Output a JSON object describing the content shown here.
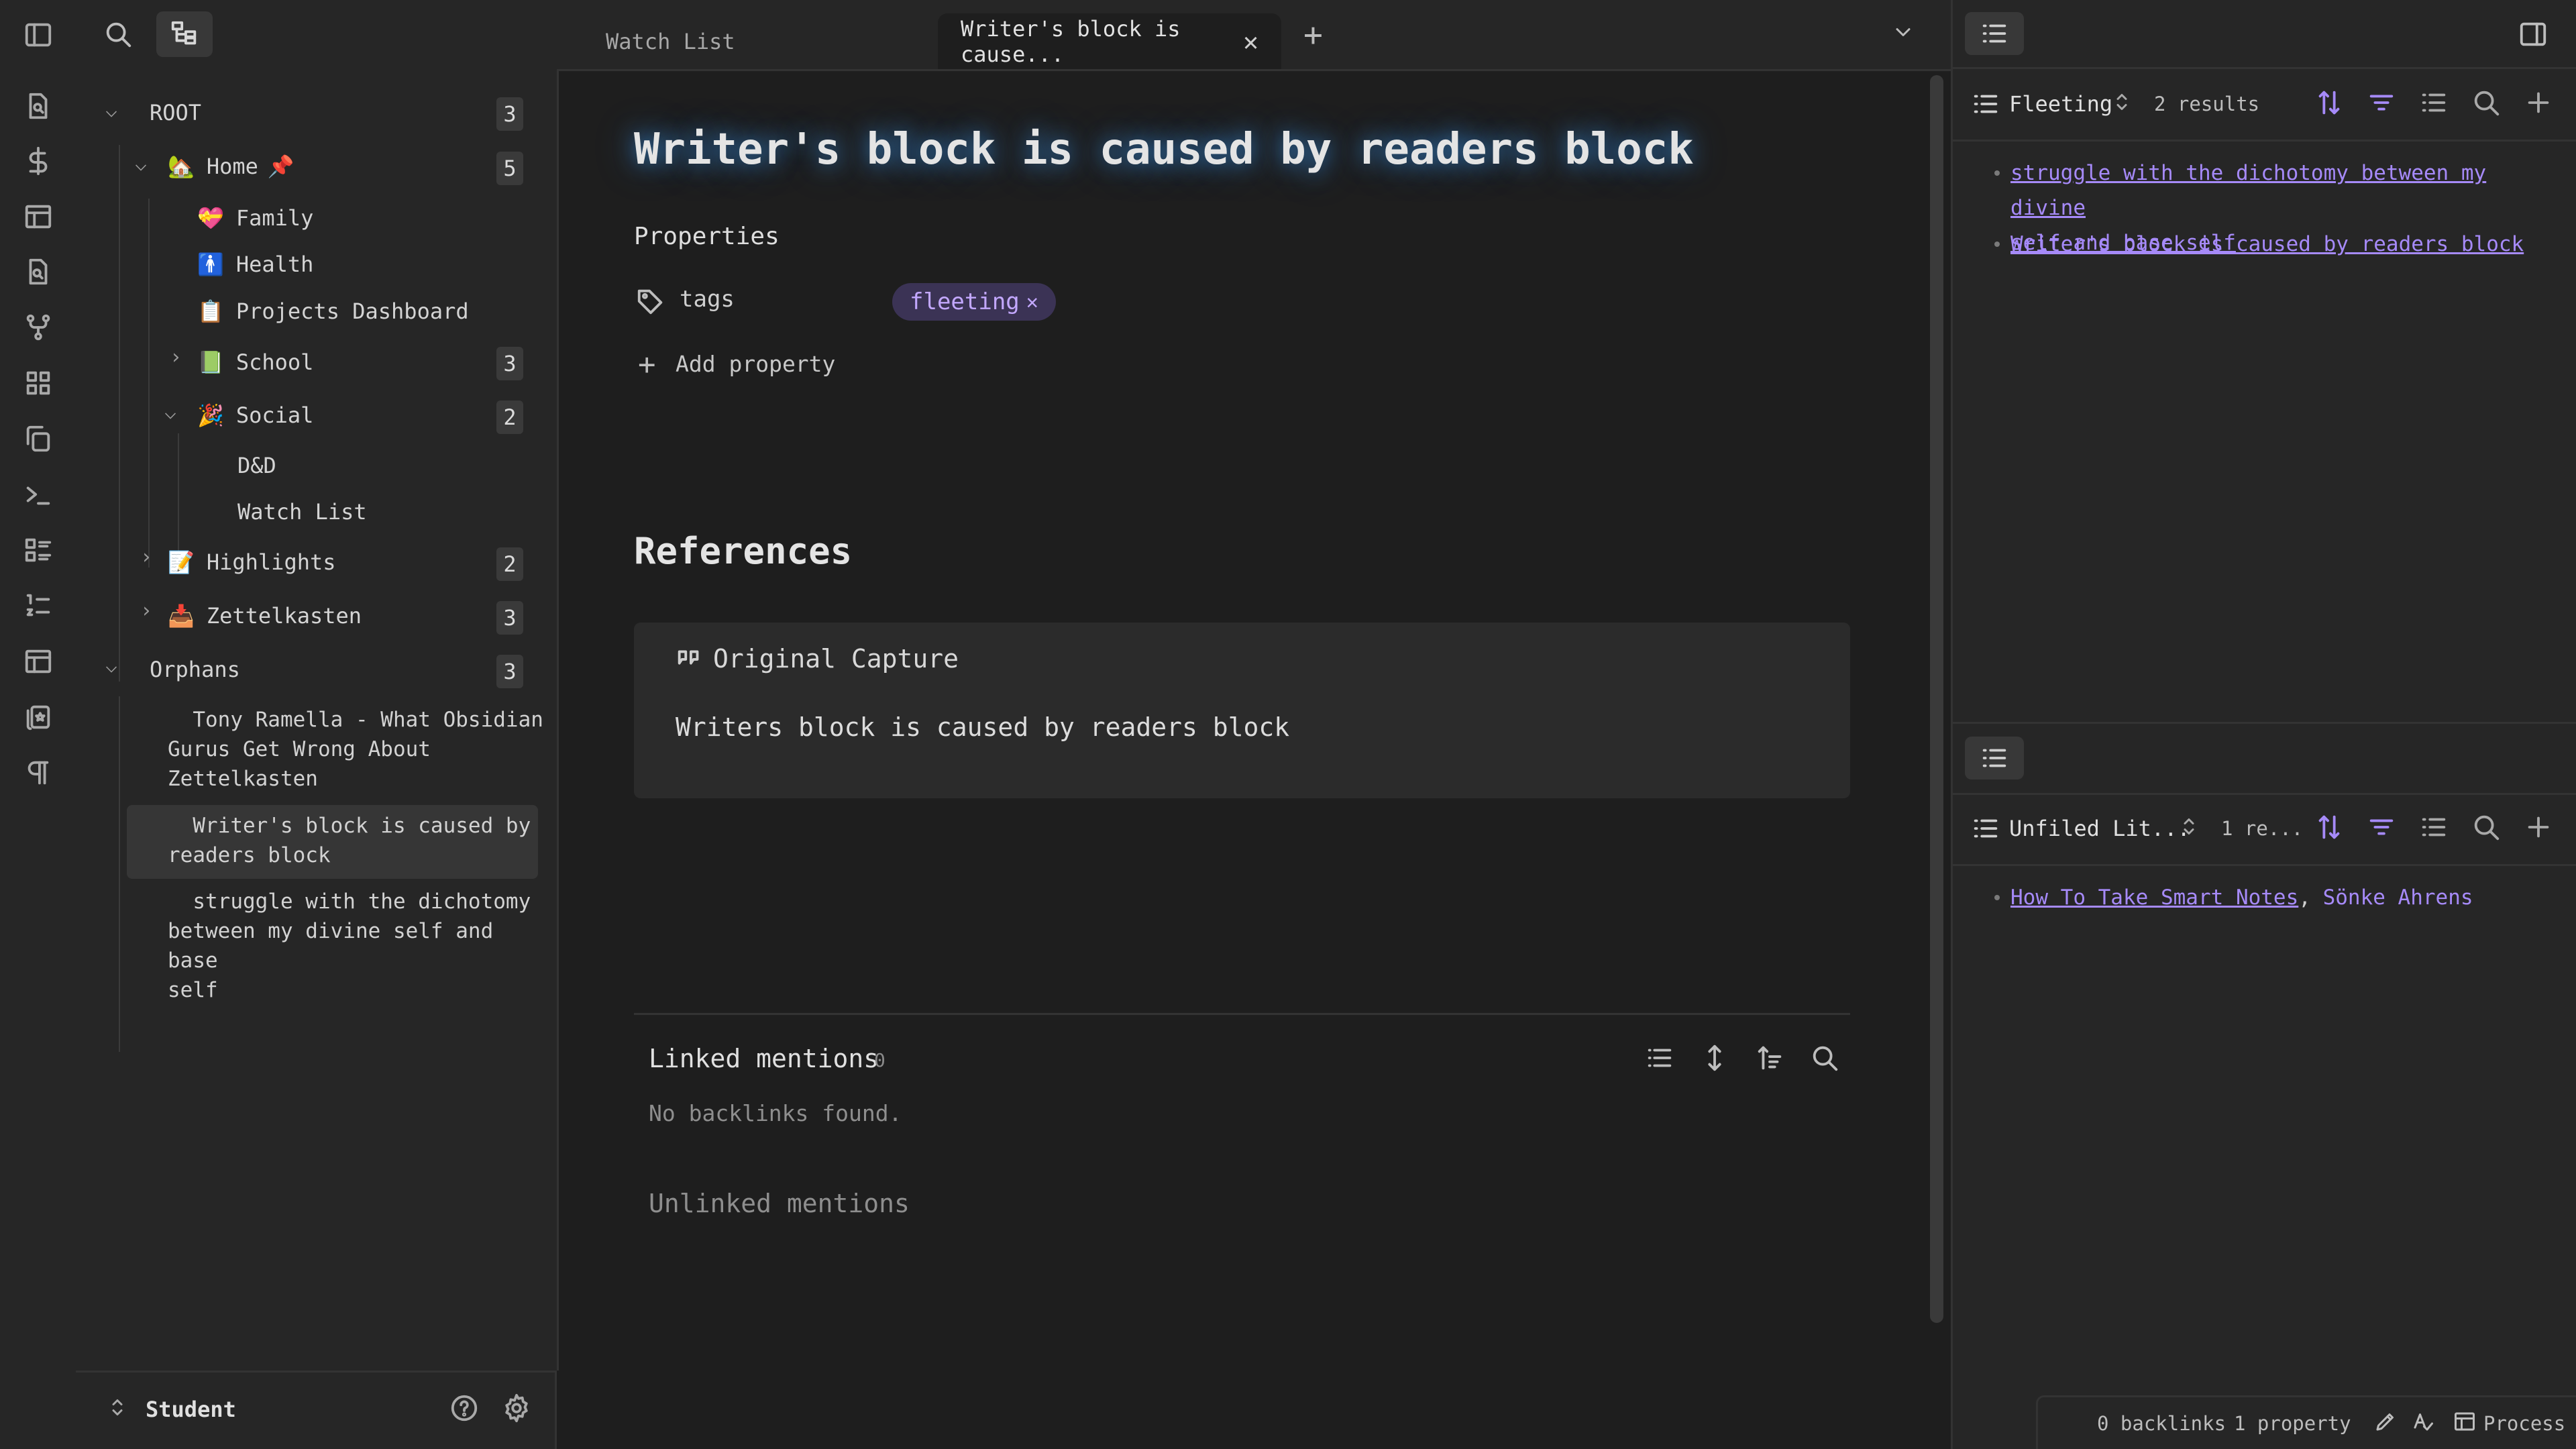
{
  "tabs": [
    {
      "label": "Watch List",
      "active": false
    },
    {
      "label": "Writer's block is cause...",
      "active": true
    }
  ],
  "explorer": {
    "root": {
      "label": "ROOT",
      "count": "3"
    },
    "home": {
      "label": "Home",
      "pin": "📌",
      "count": "5"
    },
    "family": {
      "label": "Family"
    },
    "health": {
      "label": "Health"
    },
    "projects": {
      "label": "Projects Dashboard"
    },
    "school": {
      "label": "School",
      "count": "3"
    },
    "social": {
      "label": "Social",
      "count": "2"
    },
    "dnd": {
      "label": "D&D"
    },
    "watchlist": {
      "label": "Watch List"
    },
    "highlights": {
      "label": "Highlights",
      "count": "2"
    },
    "zettelkasten": {
      "label": "Zettelkasten",
      "count": "3"
    },
    "orphans": {
      "label": "Orphans",
      "count": "3"
    },
    "orphan_items": [
      {
        "line1": "  Tony Ramella - What Obsidian",
        "line2": "Gurus Get Wrong About",
        "line3": "Zettelkasten"
      },
      {
        "line1": "  Writer's block is caused by",
        "line2": "readers block",
        "line3": ""
      },
      {
        "line1": "  struggle with the dichotomy",
        "line2": "between my divine self and base",
        "line3": "self"
      }
    ]
  },
  "footer": {
    "vault": "Student"
  },
  "note": {
    "title": "Writer's block is caused by readers block",
    "properties_heading": "Properties",
    "tags_label": "tags",
    "tag_value": "fleeting",
    "add_property": "Add property",
    "references_heading": "References",
    "capture_title": "Original Capture",
    "capture_text": "Writers block is caused by readers block",
    "linked_mentions": "Linked mentions",
    "linked_count": "0",
    "no_backlinks": "No backlinks found.",
    "unlinked_mentions": "Unlinked mentions"
  },
  "right_top": {
    "view": "Fleeting",
    "results": "2 results",
    "items": [
      {
        "line1": "struggle with the dichotomy between my divine",
        "line2": "self and base self"
      },
      {
        "line1": "Writer's block is caused by readers block",
        "line2": ""
      }
    ]
  },
  "right_bottom": {
    "view": "Unfiled Lit...",
    "results": "1 re...",
    "item_link": "How To Take Smart Notes",
    "item_sep": ",",
    "item_author": "Sönke Ahrens"
  },
  "status": {
    "backlinks": "0 backlinks",
    "properties": "1 property",
    "process": "Process"
  },
  "colors": {
    "accent": "#a68af9",
    "tag_bg": "#3b3355",
    "title_glow": "#388cdc"
  }
}
